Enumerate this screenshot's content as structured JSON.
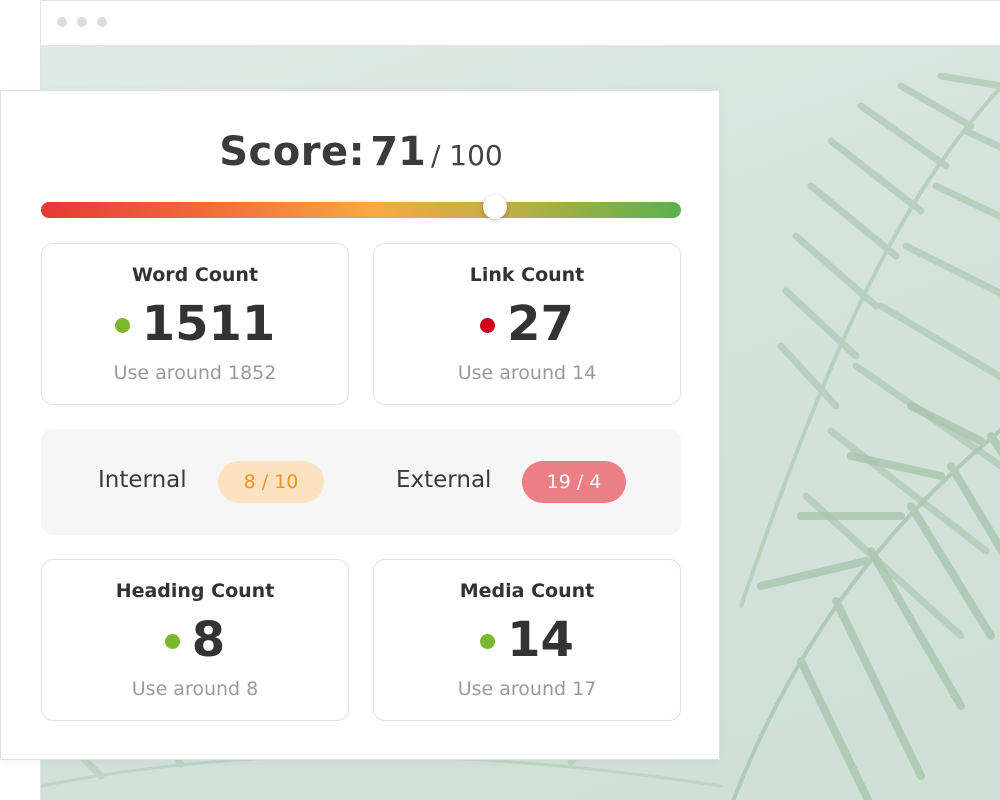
{
  "colors": {
    "good": "#7cb82f",
    "bad": "#d0021b",
    "internal_pill_bg": "#fde2c2",
    "internal_pill_text": "#f0931f",
    "external_pill_bg": "#ec7f86",
    "external_pill_text": "#ffffff"
  },
  "score": {
    "label": "Score:",
    "value": "71",
    "total": "/ 100",
    "fraction": 0.71
  },
  "metrics": {
    "word": {
      "label": "Word Count",
      "value": "1511",
      "hint": "Use around 1852",
      "status": "good"
    },
    "link": {
      "label": "Link Count",
      "value": "27",
      "hint": "Use around 14",
      "status": "bad"
    },
    "heading": {
      "label": "Heading Count",
      "value": "8",
      "hint": "Use around 8",
      "status": "good"
    },
    "media": {
      "label": "Media Count",
      "value": "14",
      "hint": "Use around 17",
      "status": "good"
    }
  },
  "links": {
    "internal": {
      "label": "Internal",
      "value": "8 / 10"
    },
    "external": {
      "label": "External",
      "value": "19 / 4"
    }
  }
}
